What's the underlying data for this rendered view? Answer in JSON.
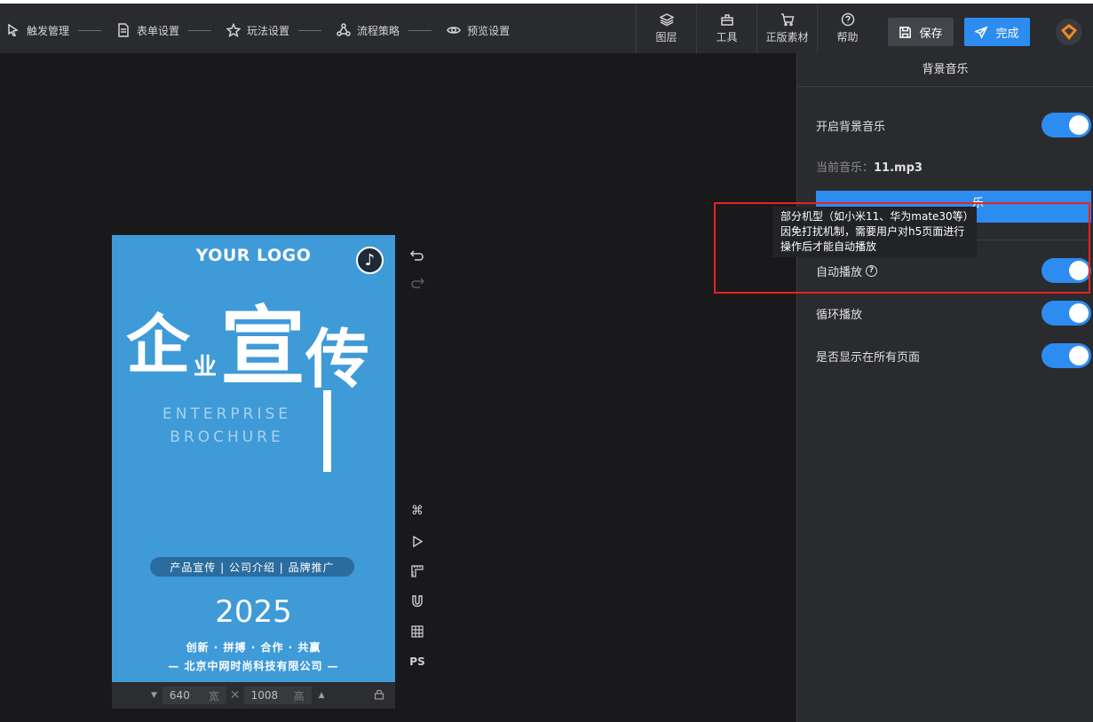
{
  "nav": {
    "steps": [
      {
        "label": "触发管理",
        "icon": "pointer-icon"
      },
      {
        "label": "表单设置",
        "icon": "form-icon"
      },
      {
        "label": "玩法设置",
        "icon": "star-icon"
      },
      {
        "label": "流程策略",
        "icon": "flow-icon"
      },
      {
        "label": "预览设置",
        "icon": "eye-icon"
      }
    ],
    "tools": [
      {
        "label": "图层",
        "icon": "layers-icon"
      },
      {
        "label": "工具",
        "icon": "toolbox-icon"
      },
      {
        "label": "正版素材",
        "icon": "cart-icon"
      },
      {
        "label": "帮助",
        "icon": "help-icon"
      }
    ],
    "save_label": "保存",
    "done_label": "完成"
  },
  "canvas": {
    "logo": "YOUR LOGO",
    "title_1": "企",
    "title_2": "业",
    "title_3": "宣",
    "title_4": "传",
    "english_1": "ENTERPRISE",
    "english_2": "BROCHURE",
    "tagline": "产品宣传 | 公司介绍 | 品牌推广",
    "year": "2025",
    "slogan": "创新 · 拼搏 · 合作 · 共赢",
    "company": "— 北京中网时尚科技有限公司 —",
    "width": "640",
    "width_label": "宽",
    "height": "1008",
    "height_label": "高",
    "ps_label": "PS"
  },
  "panel": {
    "title": "背景音乐",
    "enable_label": "开启背景音乐",
    "current_label": "当前音乐：",
    "current_file": "11.mp3",
    "select_button_visible_fragment": "乐",
    "autoplay_label": "自动播放",
    "loop_label": "循环播放",
    "all_pages_label": "是否显示在所有页面",
    "toggles": {
      "enable": true,
      "autoplay": true,
      "loop": true,
      "all_pages": true
    }
  },
  "tooltip": {
    "line1": "部分机型（如小米11、华为mate30等）",
    "line2": "因免打扰机制，需要用户对h5页面进行",
    "line3": "操作后才能自动播放"
  },
  "colors": {
    "accent": "#2d8cf0",
    "canvas_bg": "#3f9ad8",
    "highlight": "#e8231d"
  }
}
